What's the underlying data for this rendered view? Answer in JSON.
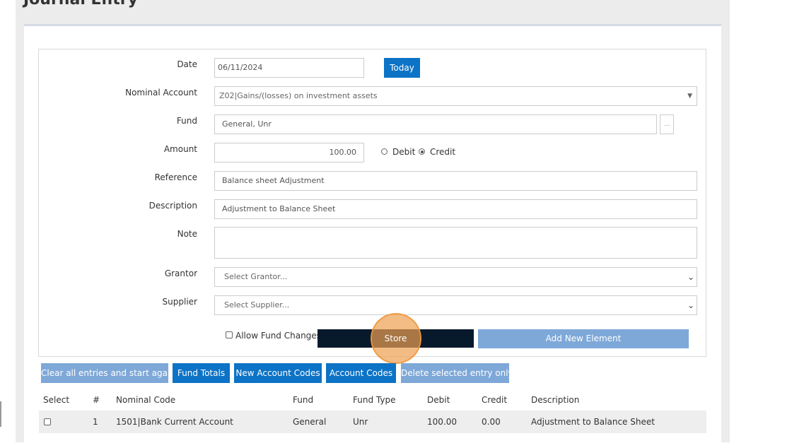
{
  "page": {
    "title": "Journal Entry"
  },
  "form": {
    "date": {
      "label": "Date",
      "value": "06/11/2024",
      "today_label": "Today"
    },
    "nominal_account": {
      "label": "Nominal Account",
      "value": "Z02|Gains/(losses) on investment assets"
    },
    "fund": {
      "label": "Fund",
      "value": "General, Unr",
      "browse_label": "..."
    },
    "amount": {
      "label": "Amount",
      "value": "100.00",
      "debit_label": "Debit",
      "credit_label": "Credit",
      "selected": "Credit"
    },
    "reference": {
      "label": "Reference",
      "value": "Balance sheet Adjustment"
    },
    "description": {
      "label": "Description",
      "value": "Adjustment to Balance Sheet"
    },
    "note": {
      "label": "Note",
      "value": ""
    },
    "grantor": {
      "label": "Grantor",
      "placeholder": "Select Grantor..."
    },
    "supplier": {
      "label": "Supplier",
      "placeholder": "Select Supplier..."
    },
    "allow_fund_changes": {
      "label": "Allow Fund Changes",
      "checked": false
    },
    "store_label": "Store",
    "add_new_label": "Add New Element"
  },
  "actions": {
    "clear_all": "Clear all entries and start again",
    "fund_totals": "Fund Totals",
    "new_account_codes": "New Account Codes",
    "account_codes": "Account Codes",
    "delete_selected": "Delete selected entry only"
  },
  "table": {
    "headers": {
      "select": "Select",
      "num": "#",
      "nominal_code": "Nominal Code",
      "fund": "Fund",
      "fund_type": "Fund Type",
      "debit": "Debit",
      "credit": "Credit",
      "description": "Description"
    },
    "rows": [
      {
        "num": "1",
        "nominal_code": "1501|Bank Current Account",
        "fund": "General",
        "fund_type": "Unr",
        "debit": "100.00",
        "credit": "0.00",
        "description": "Adjustment to Balance Sheet",
        "selected": false
      }
    ]
  },
  "colors": {
    "primary": "#0c73c6",
    "muted": "#7ea8d8",
    "store": "#071a2c",
    "highlight": "#eea050"
  }
}
